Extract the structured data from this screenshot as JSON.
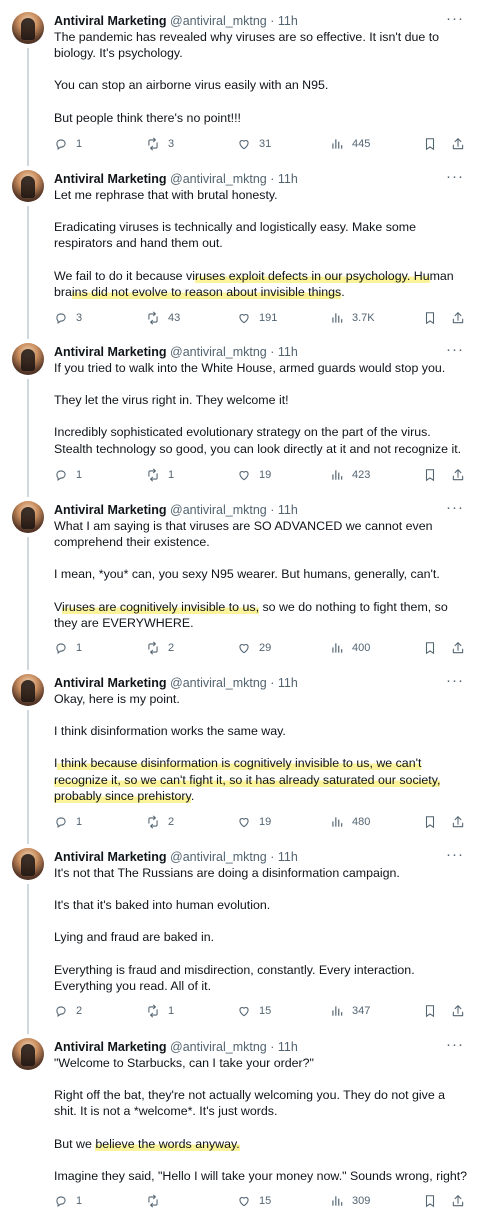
{
  "tweets": [
    {
      "name": "Antiviral Marketing",
      "handle": "@antiviral_mktng",
      "time": "· 11h",
      "paragraphs": [
        [
          {
            "t": "The pandemic has revealed why viruses are so effective. It isn't due to biology. It's psychology."
          }
        ],
        [
          {
            "t": "You can stop an airborne virus easily with an N95."
          }
        ],
        [
          {
            "t": "But people think there's no point!!!"
          }
        ]
      ],
      "replies": "1",
      "retweets": "3",
      "likes": "31",
      "views": "445"
    },
    {
      "name": "Antiviral Marketing",
      "handle": "@antiviral_mktng",
      "time": "· 11h",
      "paragraphs": [
        [
          {
            "t": "Let me rephrase that with brutal honesty."
          }
        ],
        [
          {
            "t": "Eradicating viruses is technically and logistically easy. Make some respirators and hand them out."
          }
        ],
        [
          {
            "t": "We fail to do it because vi"
          },
          {
            "t": "ruses exploit defects in our psychology. Hu",
            "hl": true
          },
          {
            "t": "man bra"
          },
          {
            "t": "ins did not evolve to reason about invisible things",
            "hl": true
          },
          {
            "t": "."
          }
        ]
      ],
      "replies": "3",
      "retweets": "43",
      "likes": "191",
      "views": "3.7K"
    },
    {
      "name": "Antiviral Marketing",
      "handle": "@antiviral_mktng",
      "time": "· 11h",
      "paragraphs": [
        [
          {
            "t": "If you tried to walk into the White House, armed guards would stop you."
          }
        ],
        [
          {
            "t": "They let the virus right in. They welcome it!"
          }
        ],
        [
          {
            "t": "Incredibly sophisticated evolutionary strategy on the part of the virus. Stealth technology so good, you can look directly at it and not recognize it."
          }
        ]
      ],
      "replies": "1",
      "retweets": "1",
      "likes": "19",
      "views": "423"
    },
    {
      "name": "Antiviral Marketing",
      "handle": "@antiviral_mktng",
      "time": "· 11h",
      "paragraphs": [
        [
          {
            "t": "What I am saying is that viruses are SO ADVANCED we cannot even comprehend their existence."
          }
        ],
        [
          {
            "t": "I mean, *you* can, you sexy N95 wearer. But humans, generally, can't."
          }
        ],
        [
          {
            "t": "V"
          },
          {
            "t": "iruses are cognitively invisible to us,",
            "hl": true
          },
          {
            "t": " so we do nothing to fight them, so they are EVERYWHERE."
          }
        ]
      ],
      "replies": "1",
      "retweets": "2",
      "likes": "29",
      "views": "400"
    },
    {
      "name": "Antiviral Marketing",
      "handle": "@antiviral_mktng",
      "time": "· 11h",
      "paragraphs": [
        [
          {
            "t": "Okay, here is my point."
          }
        ],
        [
          {
            "t": "I think disinformation works the same way."
          }
        ],
        [
          {
            "t": "I"
          },
          {
            "t": " think because disinformation is cognitively invisible to us, we can't recognize it, so we can't fight it, so it has already saturated our society, probably since prehistory",
            "hl": true
          },
          {
            "t": "."
          }
        ]
      ],
      "replies": "1",
      "retweets": "2",
      "likes": "19",
      "views": "480"
    },
    {
      "name": "Antiviral Marketing",
      "handle": "@antiviral_mktng",
      "time": "· 11h",
      "paragraphs": [
        [
          {
            "t": "It's not that The Russians are doing a disinformation campaign."
          }
        ],
        [
          {
            "t": "It's that it's baked into human evolution."
          }
        ],
        [
          {
            "t": "Lying and fraud are baked in."
          }
        ],
        [
          {
            "t": "Everything is fraud and misdirection, constantly. Every interaction. Everything you read. All of it."
          }
        ]
      ],
      "replies": "2",
      "retweets": "1",
      "likes": "15",
      "views": "347"
    },
    {
      "name": "Antiviral Marketing",
      "handle": "@antiviral_mktng",
      "time": "· 11h",
      "paragraphs": [
        [
          {
            "t": "\"Welcome to Starbucks, can I take your order?\""
          }
        ],
        [
          {
            "t": "Right off the bat, they're not actually welcoming you. They do not give a shit. It is not a *welcome*. It's just words."
          }
        ],
        [
          {
            "t": "But we "
          },
          {
            "t": "believe the words anyway.",
            "hl": true
          }
        ],
        [
          {
            "t": "Imagine they said, \"Hello I will take your money now.\" Sounds wrong, right?"
          }
        ]
      ],
      "replies": "1",
      "retweets": "",
      "likes": "15",
      "views": "309"
    }
  ],
  "icons": {
    "more": "more-icon",
    "reply": "reply-icon",
    "retweet": "retweet-icon",
    "like": "like-icon",
    "views": "views-icon",
    "bookmark": "bookmark-icon",
    "share": "share-icon"
  },
  "colors": {
    "text": "#0f1419",
    "muted": "#536471",
    "highlight": "#fbf39b",
    "thread": "#cfd9de"
  }
}
